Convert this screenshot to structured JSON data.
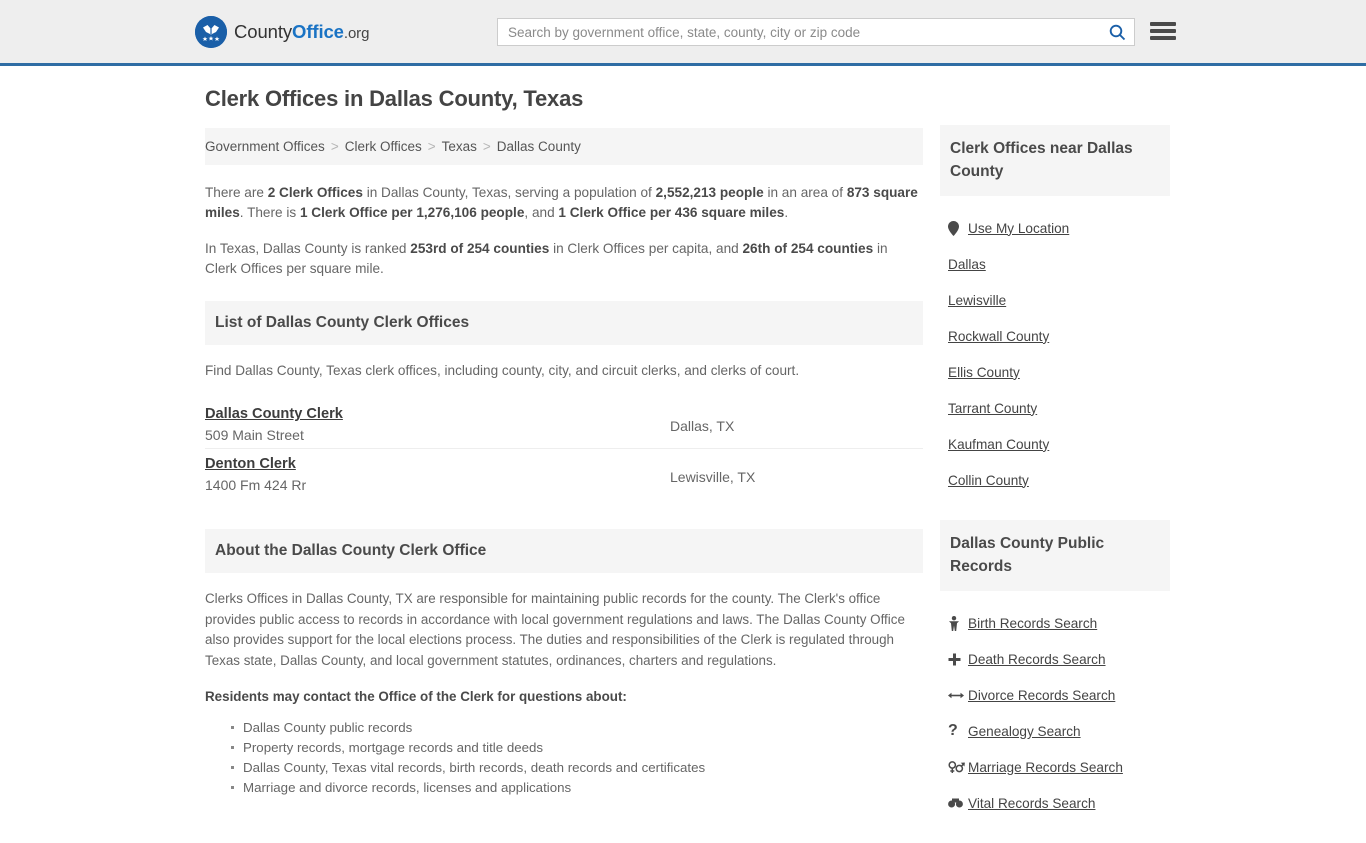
{
  "header": {
    "logo": {
      "icon": "eagle-shield-icon",
      "text_part1": "County",
      "text_part2": "Office",
      "text_part3": ".org"
    },
    "search": {
      "placeholder": "Search by government office, state, county, city or zip code",
      "value": "",
      "search_icon": "search-icon"
    },
    "menu_icon": "hamburger-menu-icon",
    "accent_color": "#2f6da4"
  },
  "main": {
    "page_title": "Clerk Offices in Dallas County, Texas",
    "breadcrumb": [
      "Government Offices",
      "Clerk Offices",
      "Texas",
      "Dallas County"
    ],
    "breadcrumb_separator": ">",
    "intro": {
      "p1_pre": "There are ",
      "p1_b1": "2 Clerk Offices",
      "p1_mid1": " in Dallas County, Texas, serving a population of ",
      "p1_b2": "2,552,213 people",
      "p1_mid2": " in an area of ",
      "p1_b3": "873 square miles",
      "p1_mid3": ". There is ",
      "p1_b4": "1 Clerk Office per 1,276,106 people",
      "p1_mid4": ", and ",
      "p1_b5": "1 Clerk Office per 436 square miles",
      "p1_end": ".",
      "p2_pre": "In Texas, Dallas County is ranked ",
      "p2_b1": "253rd of 254 counties",
      "p2_mid": " in Clerk Offices per capita, and ",
      "p2_b2": "26th of 254 counties",
      "p2_end": " in Clerk Offices per square mile."
    },
    "list_section": {
      "heading": "List of Dallas County Clerk Offices",
      "description": "Find Dallas County, Texas clerk offices, including county, city, and circuit clerks, and clerks of court.",
      "offices": [
        {
          "name": "Dallas County Clerk",
          "address": "509 Main Street",
          "city": "Dallas, TX"
        },
        {
          "name": "Denton Clerk",
          "address": "1400 Fm 424 Rr",
          "city": "Lewisville, TX"
        }
      ]
    },
    "about_section": {
      "heading": "About the Dallas County Clerk Office",
      "paragraph": "Clerks Offices in Dallas County, TX are responsible for maintaining public records for the county. The Clerk's office provides public access to records in accordance with local government regulations and laws. The Dallas County Office also provides support for the local elections process. The duties and responsibilities of the Clerk is regulated through Texas state, Dallas County, and local government statutes, ordinances, charters and regulations.",
      "subheading": "Residents may contact the Office of the Clerk for questions about:",
      "bullets": [
        "Dallas County public records",
        "Property records, mortgage records and title deeds",
        "Dallas County, Texas vital records, birth records, death records and certificates",
        "Marriage and divorce records, licenses and applications"
      ]
    }
  },
  "sidebar": {
    "nearby_card": {
      "heading": "Clerk Offices near Dallas County",
      "items": [
        {
          "label": "Use My Location",
          "icon": "map-pin-icon"
        },
        {
          "label": "Dallas",
          "icon": ""
        },
        {
          "label": "Lewisville",
          "icon": ""
        },
        {
          "label": "Rockwall County",
          "icon": ""
        },
        {
          "label": "Ellis County",
          "icon": ""
        },
        {
          "label": "Tarrant County",
          "icon": ""
        },
        {
          "label": "Kaufman County",
          "icon": ""
        },
        {
          "label": "Collin County",
          "icon": ""
        }
      ]
    },
    "records_card": {
      "heading": "Dallas County Public Records",
      "items": [
        {
          "label": "Birth Records Search",
          "icon": "baby-icon",
          "glyph": "👶"
        },
        {
          "label": "Death Records Search",
          "icon": "cross-icon",
          "glyph": "✚"
        },
        {
          "label": "Divorce Records Search",
          "icon": "divorce-arrows-icon",
          "glyph": "↔"
        },
        {
          "label": "Genealogy Search",
          "icon": "question-mark-icon",
          "glyph": "?"
        },
        {
          "label": "Marriage Records Search",
          "icon": "venus-mars-icon",
          "glyph": "⚥"
        },
        {
          "label": "Vital Records Search",
          "icon": "binoculars-icon",
          "glyph": "👓"
        }
      ]
    }
  }
}
